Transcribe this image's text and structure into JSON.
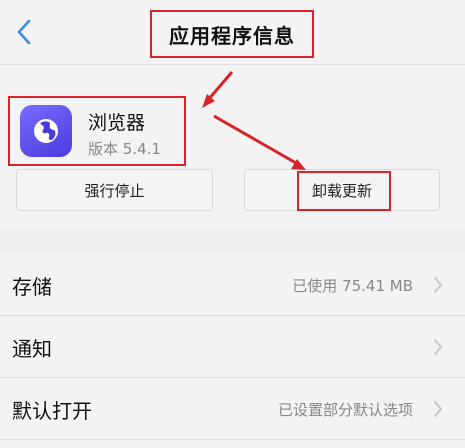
{
  "header": {
    "title": "应用程序信息",
    "back_icon": "chevron-left-icon"
  },
  "app": {
    "name": "浏览器",
    "version": "版本 5.4.1",
    "icon": "globe-icon",
    "icon_color": "#5b4cf0"
  },
  "actions": {
    "force_stop": "强行停止",
    "uninstall_updates": "卸载更新"
  },
  "settings": [
    {
      "label": "存储",
      "value": "已使用 75.41 MB"
    },
    {
      "label": "通知",
      "value": ""
    },
    {
      "label": "默认打开",
      "value": "已设置部分默认选项"
    }
  ],
  "colors": {
    "annotation_red": "#d8232a",
    "accent_blue": "#3a8ee6"
  }
}
